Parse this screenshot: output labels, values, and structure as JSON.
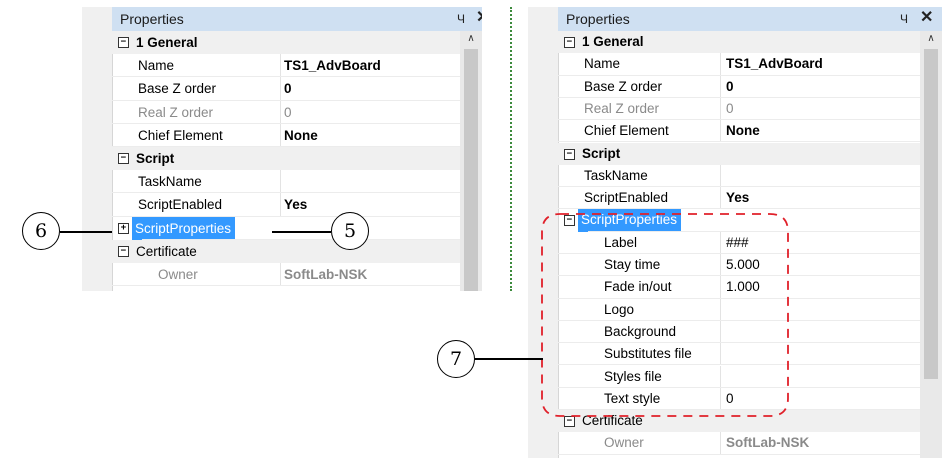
{
  "left_panel": {
    "title": "Properties",
    "pin_glyph": "Ч",
    "close_glyph": "✕",
    "rows": [
      {
        "kind": "cat",
        "box": "−",
        "name": "1 General"
      },
      {
        "kind": "prop",
        "name": "Name",
        "value": "TS1_AdvBoard",
        "value_style": "bold"
      },
      {
        "kind": "prop",
        "name": "Base Z order",
        "value": "0",
        "value_style": "bold"
      },
      {
        "kind": "prop",
        "name": "Real Z order",
        "value": "0",
        "name_style": "grey",
        "value_style": "grey"
      },
      {
        "kind": "prop",
        "name": "Chief Element",
        "value": "None",
        "value_style": "bold"
      },
      {
        "kind": "cat",
        "box": "−",
        "name": "Script"
      },
      {
        "kind": "prop",
        "name": "TaskName",
        "value": ""
      },
      {
        "kind": "prop",
        "name": "ScriptEnabled",
        "value": "Yes",
        "value_style": "bold"
      },
      {
        "kind": "subcat",
        "box": "+",
        "name": "ScriptProperties",
        "selected": true
      },
      {
        "kind": "cat2",
        "box": "−",
        "name": "Certificate"
      },
      {
        "kind": "prop",
        "name": "Owner",
        "value": "SoftLab-NSK",
        "name_style": "grey",
        "value_style": "greybold",
        "indent": true
      }
    ]
  },
  "right_panel": {
    "title": "Properties",
    "pin_glyph": "Ч",
    "close_glyph": "✕",
    "rows": [
      {
        "kind": "cat",
        "box": "−",
        "name": "1 General"
      },
      {
        "kind": "prop",
        "name": "Name",
        "value": "TS1_AdvBoard",
        "value_style": "bold"
      },
      {
        "kind": "prop",
        "name": "Base Z order",
        "value": "0",
        "value_style": "bold"
      },
      {
        "kind": "prop",
        "name": "Real Z order",
        "value": "0",
        "name_style": "grey",
        "value_style": "grey"
      },
      {
        "kind": "prop",
        "name": "Chief Element",
        "value": "None",
        "value_style": "bold"
      },
      {
        "kind": "cat",
        "box": "−",
        "name": "Script"
      },
      {
        "kind": "prop",
        "name": "TaskName",
        "value": ""
      },
      {
        "kind": "prop",
        "name": "ScriptEnabled",
        "value": "Yes",
        "value_style": "bold"
      },
      {
        "kind": "subcat",
        "box": "−",
        "name": "ScriptProperties",
        "selected": true
      },
      {
        "kind": "prop",
        "name": "Label",
        "value": "###",
        "indent": true
      },
      {
        "kind": "prop",
        "name": "Stay time",
        "value": "5.000",
        "indent": true
      },
      {
        "kind": "prop",
        "name": "Fade in/out",
        "value": "1.000",
        "indent": true
      },
      {
        "kind": "prop",
        "name": "Logo",
        "value": "",
        "indent": true
      },
      {
        "kind": "prop",
        "name": "Background",
        "value": "",
        "indent": true
      },
      {
        "kind": "prop",
        "name": "Substitutes file",
        "value": "",
        "indent": true
      },
      {
        "kind": "prop",
        "name": "Styles file",
        "value": "",
        "indent": true
      },
      {
        "kind": "prop",
        "name": "Text style",
        "value": "0",
        "indent": true
      },
      {
        "kind": "cat2",
        "box": "−",
        "name": "Certificate"
      },
      {
        "kind": "prop",
        "name": "Owner",
        "value": "SoftLab-NSK",
        "name_style": "grey",
        "value_style": "greybold",
        "indent": true
      }
    ]
  },
  "callouts": {
    "six": "6",
    "five": "5",
    "seven": "7"
  },
  "colors": {
    "selection": "#3399ff",
    "title_bar": "#cfe0f2",
    "dashed_outline": "#e0202a",
    "divider": "#3c8a3c"
  }
}
